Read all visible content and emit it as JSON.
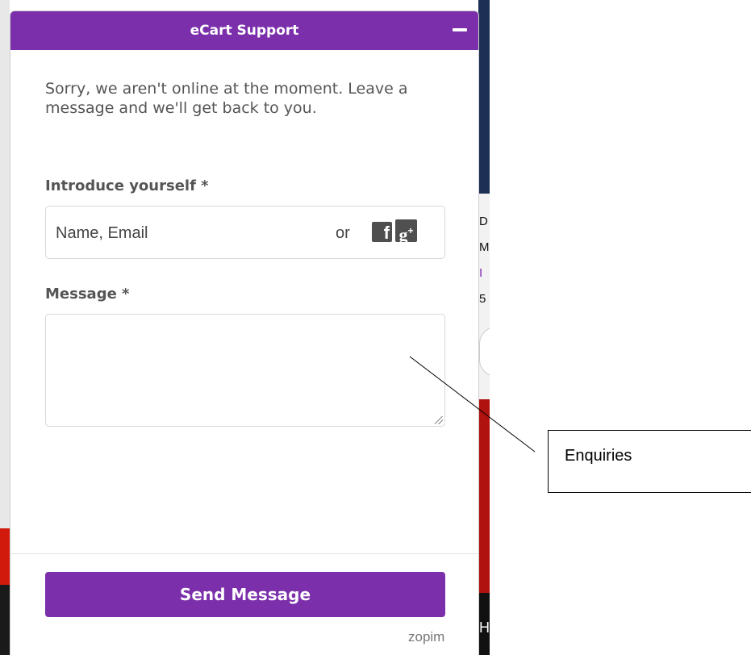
{
  "widget": {
    "title": "eCart Support",
    "offline_message": "Sorry, we aren't online at the moment. Leave a message and we'll get back to you.",
    "intro_label": "Introduce yourself *",
    "name_placeholder": "Name, Email",
    "or_text": "or",
    "facebook_glyph": "f",
    "google_glyph": "g",
    "google_plus": "+",
    "message_label": "Message *",
    "message_value": "",
    "send_label": "Send Message",
    "brand": "zopim",
    "accent_color": "#7b2fab"
  },
  "background_page": {
    "fragments": [
      "D",
      "M",
      "I",
      "5",
      "H"
    ]
  },
  "annotation": {
    "label": "Enquiries"
  }
}
